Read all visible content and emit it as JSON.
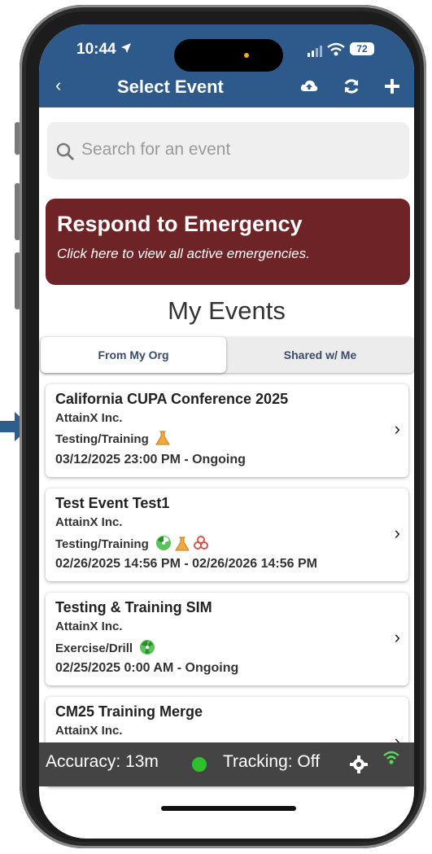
{
  "colors": {
    "header": "#2d5a8a",
    "emergency": "#6e2426",
    "tracking_dot": "#2ec02e",
    "bottom_bar": "#444444",
    "pointer_arrow": "#2e5f8c"
  },
  "status": {
    "time": "10:44",
    "battery": "72"
  },
  "nav": {
    "back_icon": "chevron-left-icon",
    "title": "Select Event",
    "actions": [
      "cloud-upload-icon",
      "refresh-icon",
      "plus-icon"
    ]
  },
  "search": {
    "placeholder": "Search for an event"
  },
  "emergency": {
    "title": "Respond to Emergency",
    "subtitle": "Click here to view all active emergencies."
  },
  "my_events": {
    "heading": "My Events",
    "tabs": [
      {
        "label": "From My Org",
        "active": true
      },
      {
        "label": "Shared w/ Me",
        "active": false
      }
    ],
    "events": [
      {
        "title": "California CUPA Conference 2025",
        "org": "AttainX Inc.",
        "type": "Testing/Training",
        "icons": [
          "flask-icon"
        ],
        "date": "03/12/2025 23:00 PM - Ongoing"
      },
      {
        "title": "Test Event Test1",
        "org": "AttainX Inc.",
        "type": "Testing/Training",
        "icons": [
          "radiation-icon",
          "flask-icon",
          "biohazard-icon"
        ],
        "date": "02/26/2025 14:56 PM - 02/26/2026 14:56 PM"
      },
      {
        "title": "Testing & Training SIM",
        "org": "AttainX Inc.",
        "type": "Exercise/Drill",
        "icons": [
          "radiation-icon"
        ],
        "date": "02/25/2025 0:00 AM - Ongoing"
      },
      {
        "title": "CM25 Training Merge",
        "org": "AttainX Inc.",
        "type": "",
        "icons": [],
        "date": ""
      }
    ]
  },
  "bottom_bar": {
    "accuracy": "Accuracy:  13m",
    "tracking": "Tracking:  Off"
  }
}
